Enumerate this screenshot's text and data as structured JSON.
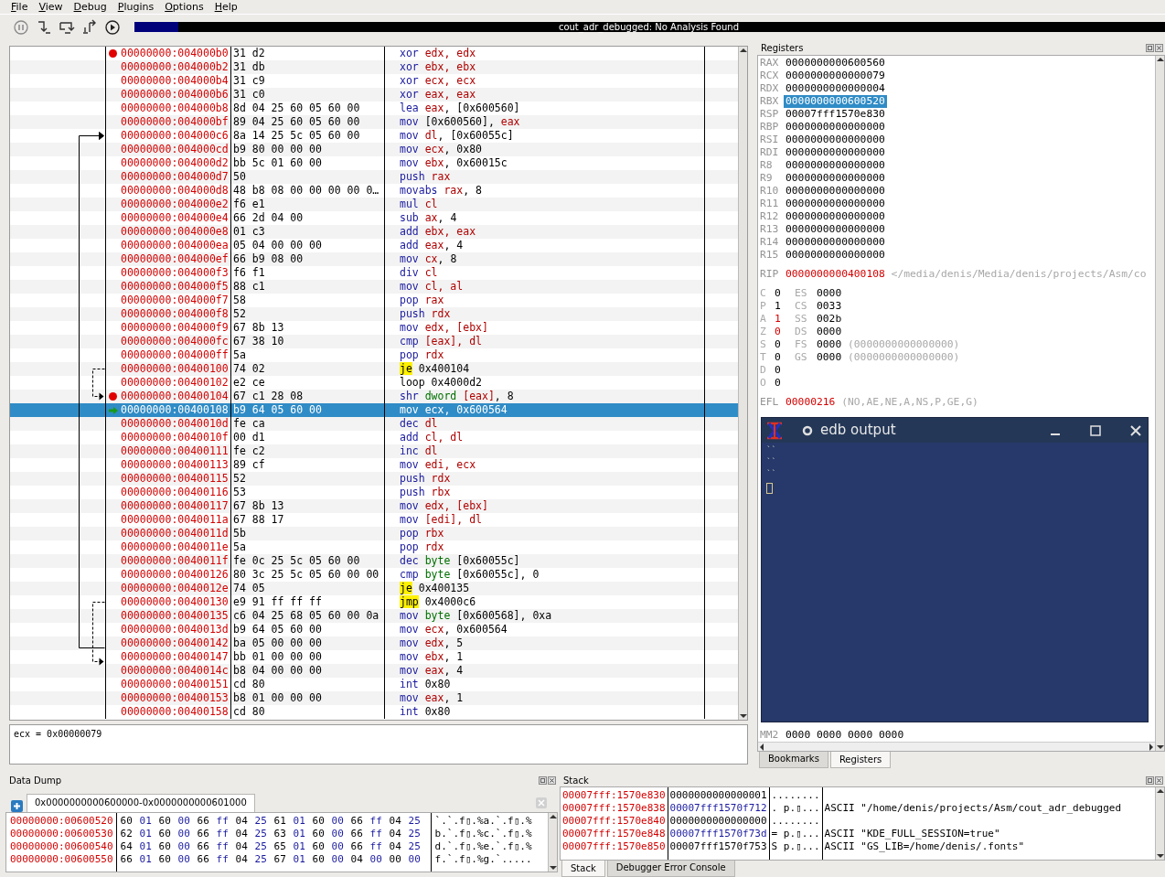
{
  "menu": [
    {
      "label": "File"
    },
    {
      "label": "View"
    },
    {
      "label": "Debug"
    },
    {
      "label": "Plugins"
    },
    {
      "label": "Options"
    },
    {
      "label": "Help"
    }
  ],
  "analysis": {
    "level": 0.043,
    "text": "cout_adr_debugged: No Analysis Found"
  },
  "disassembly": [
    {
      "address": "00000000:004000b0",
      "bytes": "31 d2",
      "mnemonic": "xor",
      "kind": "op",
      "ops": [
        {
          "kind": "r",
          "text": "edx, edx"
        }
      ],
      "breakpoint": true,
      "current": false
    },
    {
      "address": "00000000:004000b2",
      "bytes": "31 db",
      "mnemonic": "xor",
      "kind": "op",
      "ops": [
        {
          "kind": "r",
          "text": "ebx, ebx"
        }
      ],
      "breakpoint": false,
      "current": false
    },
    {
      "address": "00000000:004000b4",
      "bytes": "31 c9",
      "mnemonic": "xor",
      "kind": "op",
      "ops": [
        {
          "kind": "r",
          "text": "ecx, ecx"
        }
      ],
      "breakpoint": false,
      "current": false
    },
    {
      "address": "00000000:004000b6",
      "bytes": "31 c0",
      "mnemonic": "xor",
      "kind": "op",
      "ops": [
        {
          "kind": "r",
          "text": "eax, eax"
        }
      ],
      "breakpoint": false,
      "current": false
    },
    {
      "address": "00000000:004000b8",
      "bytes": "8d 04 25 60 05 60 00",
      "mnemonic": "lea",
      "kind": "op",
      "ops": [
        {
          "kind": "r",
          "text": "eax"
        },
        {
          "kind": "n",
          "text": ", [0x600560]"
        }
      ],
      "breakpoint": false,
      "current": false
    },
    {
      "address": "00000000:004000bf",
      "bytes": "89 04 25 60 05 60 00",
      "mnemonic": "mov",
      "kind": "op",
      "ops": [
        {
          "kind": "n",
          "text": "[0x600560], "
        },
        {
          "kind": "r",
          "text": "eax"
        }
      ],
      "breakpoint": false,
      "current": false
    },
    {
      "address": "00000000:004000c6",
      "bytes": "8a 14 25 5c 05 60 00",
      "mnemonic": "mov",
      "kind": "op",
      "ops": [
        {
          "kind": "r",
          "text": "dl"
        },
        {
          "kind": "n",
          "text": ", [0x60055c]"
        }
      ],
      "breakpoint": false,
      "current": false
    },
    {
      "address": "00000000:004000cd",
      "bytes": "b9 80 00 00 00",
      "mnemonic": "mov",
      "kind": "op",
      "ops": [
        {
          "kind": "r",
          "text": "ecx"
        },
        {
          "kind": "n",
          "text": ", 0x80"
        }
      ],
      "breakpoint": false,
      "current": false
    },
    {
      "address": "00000000:004000d2",
      "bytes": "bb 5c 01 60 00",
      "mnemonic": "mov",
      "kind": "op",
      "ops": [
        {
          "kind": "r",
          "text": "ebx"
        },
        {
          "kind": "n",
          "text": ", 0x60015c"
        }
      ],
      "breakpoint": false,
      "current": false
    },
    {
      "address": "00000000:004000d7",
      "bytes": "50",
      "mnemonic": "push",
      "kind": "op",
      "ops": [
        {
          "kind": "r",
          "text": "rax"
        }
      ],
      "breakpoint": false,
      "current": false
    },
    {
      "address": "00000000:004000d8",
      "bytes": "48 b8 08 00 00 00 00 0…",
      "mnemonic": "movabs",
      "kind": "op",
      "ops": [
        {
          "kind": "r",
          "text": "rax"
        },
        {
          "kind": "n",
          "text": ", 8"
        }
      ],
      "breakpoint": false,
      "current": false
    },
    {
      "address": "00000000:004000e2",
      "bytes": "f6 e1",
      "mnemonic": "mul",
      "kind": "op",
      "ops": [
        {
          "kind": "r",
          "text": "cl"
        }
      ],
      "breakpoint": false,
      "current": false
    },
    {
      "address": "00000000:004000e4",
      "bytes": "66 2d 04 00",
      "mnemonic": "sub",
      "kind": "op",
      "ops": [
        {
          "kind": "r",
          "text": "ax"
        },
        {
          "kind": "n",
          "text": ", 4"
        }
      ],
      "breakpoint": false,
      "current": false
    },
    {
      "address": "00000000:004000e8",
      "bytes": "01 c3",
      "mnemonic": "add",
      "kind": "op",
      "ops": [
        {
          "kind": "r",
          "text": "ebx, eax"
        }
      ],
      "breakpoint": false,
      "current": false
    },
    {
      "address": "00000000:004000ea",
      "bytes": "05 04 00 00 00",
      "mnemonic": "add",
      "kind": "op",
      "ops": [
        {
          "kind": "r",
          "text": "eax"
        },
        {
          "kind": "n",
          "text": ", 4"
        }
      ],
      "breakpoint": false,
      "current": false
    },
    {
      "address": "00000000:004000ef",
      "bytes": "66 b9 08 00",
      "mnemonic": "mov",
      "kind": "op",
      "ops": [
        {
          "kind": "r",
          "text": "cx"
        },
        {
          "kind": "n",
          "text": ", 8"
        }
      ],
      "breakpoint": false,
      "current": false
    },
    {
      "address": "00000000:004000f3",
      "bytes": "f6 f1",
      "mnemonic": "div",
      "kind": "op",
      "ops": [
        {
          "kind": "r",
          "text": "cl"
        }
      ],
      "breakpoint": false,
      "current": false
    },
    {
      "address": "00000000:004000f5",
      "bytes": "88 c1",
      "mnemonic": "mov",
      "kind": "op",
      "ops": [
        {
          "kind": "r",
          "text": "cl, al"
        }
      ],
      "breakpoint": false,
      "current": false
    },
    {
      "address": "00000000:004000f7",
      "bytes": "58",
      "mnemonic": "pop",
      "kind": "op",
      "ops": [
        {
          "kind": "r",
          "text": "rax"
        }
      ],
      "breakpoint": false,
      "current": false
    },
    {
      "address": "00000000:004000f8",
      "bytes": "52",
      "mnemonic": "push",
      "kind": "op",
      "ops": [
        {
          "kind": "r",
          "text": "rdx"
        }
      ],
      "breakpoint": false,
      "current": false
    },
    {
      "address": "00000000:004000f9",
      "bytes": "67 8b 13",
      "mnemonic": "mov",
      "kind": "op",
      "ops": [
        {
          "kind": "r",
          "text": "edx, [ebx]"
        }
      ],
      "breakpoint": false,
      "current": false
    },
    {
      "address": "00000000:004000fc",
      "bytes": "67 38 10",
      "mnemonic": "cmp",
      "kind": "op",
      "ops": [
        {
          "kind": "r",
          "text": "[eax], dl"
        }
      ],
      "breakpoint": false,
      "current": false
    },
    {
      "address": "00000000:004000ff",
      "bytes": "5a",
      "mnemonic": "pop",
      "kind": "op",
      "ops": [
        {
          "kind": "r",
          "text": "rdx"
        }
      ],
      "breakpoint": false,
      "current": false
    },
    {
      "address": "00000000:00400100",
      "bytes": "74 02",
      "mnemonic": "je",
      "kind": "jump",
      "ops": [
        {
          "kind": "n",
          "text": "0x400104"
        }
      ],
      "breakpoint": false,
      "current": false
    },
    {
      "address": "00000000:00400102",
      "bytes": "e2 ce",
      "mnemonic": "loop",
      "kind": "loop",
      "ops": [
        {
          "kind": "n",
          "text": "0x4000d2"
        }
      ],
      "breakpoint": false,
      "current": false
    },
    {
      "address": "00000000:00400104",
      "bytes": "67 c1 28 08",
      "mnemonic": "shr",
      "kind": "op",
      "ops": [
        {
          "kind": "s",
          "text": "dword "
        },
        {
          "kind": "r",
          "text": "[eax]"
        },
        {
          "kind": "n",
          "text": ", 8"
        }
      ],
      "breakpoint": true,
      "current": false
    },
    {
      "address": "00000000:00400108",
      "bytes": "b9 64 05 60 00",
      "mnemonic": "mov",
      "kind": "op",
      "ops": [
        {
          "kind": "r",
          "text": "ecx"
        },
        {
          "kind": "n",
          "text": ", 0x600564"
        }
      ],
      "breakpoint": false,
      "current": true
    },
    {
      "address": "00000000:0040010d",
      "bytes": "fe ca",
      "mnemonic": "dec",
      "kind": "op",
      "ops": [
        {
          "kind": "r",
          "text": "dl"
        }
      ],
      "breakpoint": false,
      "current": false
    },
    {
      "address": "00000000:0040010f",
      "bytes": "00 d1",
      "mnemonic": "add",
      "kind": "op",
      "ops": [
        {
          "kind": "r",
          "text": "cl, dl"
        }
      ],
      "breakpoint": false,
      "current": false
    },
    {
      "address": "00000000:00400111",
      "bytes": "fe c2",
      "mnemonic": "inc",
      "kind": "op",
      "ops": [
        {
          "kind": "r",
          "text": "dl"
        }
      ],
      "breakpoint": false,
      "current": false
    },
    {
      "address": "00000000:00400113",
      "bytes": "89 cf",
      "mnemonic": "mov",
      "kind": "op",
      "ops": [
        {
          "kind": "r",
          "text": "edi, ecx"
        }
      ],
      "breakpoint": false,
      "current": false
    },
    {
      "address": "00000000:00400115",
      "bytes": "52",
      "mnemonic": "push",
      "kind": "op",
      "ops": [
        {
          "kind": "r",
          "text": "rdx"
        }
      ],
      "breakpoint": false,
      "current": false
    },
    {
      "address": "00000000:00400116",
      "bytes": "53",
      "mnemonic": "push",
      "kind": "op",
      "ops": [
        {
          "kind": "r",
          "text": "rbx"
        }
      ],
      "breakpoint": false,
      "current": false
    },
    {
      "address": "00000000:00400117",
      "bytes": "67 8b 13",
      "mnemonic": "mov",
      "kind": "op",
      "ops": [
        {
          "kind": "r",
          "text": "edx, [ebx]"
        }
      ],
      "breakpoint": false,
      "current": false
    },
    {
      "address": "00000000:0040011a",
      "bytes": "67 88 17",
      "mnemonic": "mov",
      "kind": "op",
      "ops": [
        {
          "kind": "r",
          "text": "[edi], dl"
        }
      ],
      "breakpoint": false,
      "current": false
    },
    {
      "address": "00000000:0040011d",
      "bytes": "5b",
      "mnemonic": "pop",
      "kind": "op",
      "ops": [
        {
          "kind": "r",
          "text": "rbx"
        }
      ],
      "breakpoint": false,
      "current": false
    },
    {
      "address": "00000000:0040011e",
      "bytes": "5a",
      "mnemonic": "pop",
      "kind": "op",
      "ops": [
        {
          "kind": "r",
          "text": "rdx"
        }
      ],
      "breakpoint": false,
      "current": false
    },
    {
      "address": "00000000:0040011f",
      "bytes": "fe 0c 25 5c 05 60 00",
      "mnemonic": "dec",
      "kind": "op",
      "ops": [
        {
          "kind": "s",
          "text": "byte "
        },
        {
          "kind": "n",
          "text": "[0x60055c]"
        }
      ],
      "breakpoint": false,
      "current": false
    },
    {
      "address": "00000000:00400126",
      "bytes": "80 3c 25 5c 05 60 00 00",
      "mnemonic": "cmp",
      "kind": "op",
      "ops": [
        {
          "kind": "s",
          "text": "byte "
        },
        {
          "kind": "n",
          "text": "[0x60055c], 0"
        }
      ],
      "breakpoint": false,
      "current": false
    },
    {
      "address": "00000000:0040012e",
      "bytes": "74 05",
      "mnemonic": "je",
      "kind": "jump",
      "ops": [
        {
          "kind": "n",
          "text": "0x400135"
        }
      ],
      "breakpoint": false,
      "current": false
    },
    {
      "address": "00000000:00400130",
      "bytes": "e9 91 ff ff ff",
      "mnemonic": "jmp",
      "kind": "jump",
      "ops": [
        {
          "kind": "n",
          "text": "0x4000c6"
        }
      ],
      "breakpoint": false,
      "current": false
    },
    {
      "address": "00000000:00400135",
      "bytes": "c6 04 25 68 05 60 00 0a",
      "mnemonic": "mov",
      "kind": "op",
      "ops": [
        {
          "kind": "s",
          "text": "byte "
        },
        {
          "kind": "n",
          "text": "[0x600568], 0xa"
        }
      ],
      "breakpoint": false,
      "current": false
    },
    {
      "address": "00000000:0040013d",
      "bytes": "b9 64 05 60 00",
      "mnemonic": "mov",
      "kind": "op",
      "ops": [
        {
          "kind": "r",
          "text": "ecx"
        },
        {
          "kind": "n",
          "text": ", 0x600564"
        }
      ],
      "breakpoint": false,
      "current": false
    },
    {
      "address": "00000000:00400142",
      "bytes": "ba 05 00 00 00",
      "mnemonic": "mov",
      "kind": "op",
      "ops": [
        {
          "kind": "r",
          "text": "edx"
        },
        {
          "kind": "n",
          "text": ", 5"
        }
      ],
      "breakpoint": false,
      "current": false
    },
    {
      "address": "00000000:00400147",
      "bytes": "bb 01 00 00 00",
      "mnemonic": "mov",
      "kind": "op",
      "ops": [
        {
          "kind": "r",
          "text": "ebx"
        },
        {
          "kind": "n",
          "text": ", 1"
        }
      ],
      "breakpoint": false,
      "current": false
    },
    {
      "address": "00000000:0040014c",
      "bytes": "b8 04 00 00 00",
      "mnemonic": "mov",
      "kind": "op",
      "ops": [
        {
          "kind": "r",
          "text": "eax"
        },
        {
          "kind": "n",
          "text": ", 4"
        }
      ],
      "breakpoint": false,
      "current": false
    },
    {
      "address": "00000000:00400151",
      "bytes": "cd 80",
      "mnemonic": "int",
      "kind": "op",
      "ops": [
        {
          "kind": "n",
          "text": "0x80"
        }
      ],
      "breakpoint": false,
      "current": false
    },
    {
      "address": "00000000:00400153",
      "bytes": "b8 01 00 00 00",
      "mnemonic": "mov",
      "kind": "op",
      "ops": [
        {
          "kind": "r",
          "text": "eax"
        },
        {
          "kind": "n",
          "text": ", 1"
        }
      ],
      "breakpoint": false,
      "current": false
    },
    {
      "address": "00000000:00400158",
      "bytes": "cd 80",
      "mnemonic": "int",
      "kind": "op",
      "ops": [
        {
          "kind": "n",
          "text": "0x80"
        }
      ],
      "breakpoint": false,
      "current": false
    }
  ],
  "status": "ecx = 0x00000079",
  "registers": {
    "title": "Registers",
    "general": [
      {
        "name": "RAX",
        "value": "0000000000600560",
        "selected": false
      },
      {
        "name": "RCX",
        "value": "0000000000000079",
        "selected": false
      },
      {
        "name": "RDX",
        "value": "0000000000000004",
        "selected": false
      },
      {
        "name": "RBX",
        "value": "0000000000600520",
        "selected": true
      },
      {
        "name": "RSP",
        "value": "00007fff1570e830",
        "selected": false
      },
      {
        "name": "RBP",
        "value": "0000000000000000",
        "selected": false
      },
      {
        "name": "RSI",
        "value": "0000000000000000",
        "selected": false
      },
      {
        "name": "RDI",
        "value": "0000000000000000",
        "selected": false
      },
      {
        "name": "R8",
        "value": "0000000000000000",
        "selected": false
      },
      {
        "name": "R9",
        "value": "0000000000000000",
        "selected": false
      },
      {
        "name": "R10",
        "value": "0000000000000000",
        "selected": false
      },
      {
        "name": "R11",
        "value": "0000000000000000",
        "selected": false
      },
      {
        "name": "R12",
        "value": "0000000000000000",
        "selected": false
      },
      {
        "name": "R13",
        "value": "0000000000000000",
        "selected": false
      },
      {
        "name": "R14",
        "value": "0000000000000000",
        "selected": false
      },
      {
        "name": "R15",
        "value": "0000000000000000",
        "selected": false
      }
    ],
    "rip": {
      "name": "RIP",
      "value": "0000000000400108",
      "symbol": "</media/denis/Media/denis/projects/Asm/co"
    },
    "flags": [
      {
        "name": "C",
        "value": "0",
        "changed": false
      },
      {
        "name": "P",
        "value": "1",
        "changed": false
      },
      {
        "name": "A",
        "value": "1",
        "changed": true
      },
      {
        "name": "Z",
        "value": "0",
        "changed": true
      },
      {
        "name": "S",
        "value": "0",
        "changed": false
      },
      {
        "name": "T",
        "value": "0",
        "changed": false
      },
      {
        "name": "D",
        "value": "0",
        "changed": false
      },
      {
        "name": "O",
        "value": "0",
        "changed": false
      }
    ],
    "segments": [
      {
        "name": "ES",
        "value": "0000"
      },
      {
        "name": "CS",
        "value": "0033"
      },
      {
        "name": "SS",
        "value": "002b"
      },
      {
        "name": "DS",
        "value": "0000"
      },
      {
        "name": "FS",
        "value": "0000",
        "base": "(0000000000000000)"
      },
      {
        "name": "GS",
        "value": "0000",
        "base": "(0000000000000000)"
      }
    ],
    "efl": {
      "name": "EFL",
      "value": "00000216",
      "decoded": "(NO,AE,NE,A,NS,P,GE,G)"
    },
    "mm2": {
      "name": "MM2",
      "value": "0000 0000 0000 0000"
    },
    "tabs": [
      {
        "label": "Bookmarks",
        "selected": false
      },
      {
        "label": "Registers",
        "selected": true
      }
    ]
  },
  "output_window": {
    "title": "edb output",
    "lines": [
      "``",
      "``",
      "``"
    ]
  },
  "data_dump": {
    "title": "Data Dump",
    "tab": "0x0000000000600000-0x0000000000601000",
    "rows": [
      {
        "address": "00000000:00600520",
        "bytes": [
          "60",
          "01",
          "60",
          "00",
          "66",
          "ff",
          "04",
          "25",
          "61",
          "01",
          "60",
          "00",
          "66",
          "ff",
          "04",
          "25"
        ],
        "ascii": "`.`.f▯.%a.`.f▯.%"
      },
      {
        "address": "00000000:00600530",
        "bytes": [
          "62",
          "01",
          "60",
          "00",
          "66",
          "ff",
          "04",
          "25",
          "63",
          "01",
          "60",
          "00",
          "66",
          "ff",
          "04",
          "25"
        ],
        "ascii": "b.`.f▯.%c.`.f▯.%"
      },
      {
        "address": "00000000:00600540",
        "bytes": [
          "64",
          "01",
          "60",
          "00",
          "66",
          "ff",
          "04",
          "25",
          "65",
          "01",
          "60",
          "00",
          "66",
          "ff",
          "04",
          "25"
        ],
        "ascii": "d.`.f▯.%e.`.f▯.%"
      },
      {
        "address": "00000000:00600550",
        "bytes": [
          "66",
          "01",
          "60",
          "00",
          "66",
          "ff",
          "04",
          "25",
          "67",
          "01",
          "60",
          "00",
          "04",
          "00",
          "00",
          "00"
        ],
        "ascii": "f.`.f▯.%g.`....."
      }
    ]
  },
  "stack": {
    "title": "Stack",
    "rows": [
      {
        "address": "00007fff:1570e830",
        "value": "0000000000000001",
        "pointer": false,
        "ascii": "........",
        "comment": ""
      },
      {
        "address": "00007fff:1570e838",
        "value": "00007fff1570f712",
        "pointer": true,
        "ascii": ". p.▯...",
        "comment": "ASCII \"/home/denis/projects/Asm/cout_adr_debugged"
      },
      {
        "address": "00007fff:1570e840",
        "value": "0000000000000000",
        "pointer": false,
        "ascii": "........",
        "comment": ""
      },
      {
        "address": "00007fff:1570e848",
        "value": "00007fff1570f73d",
        "pointer": true,
        "ascii": "= p.▯...",
        "comment": "ASCII \"KDE_FULL_SESSION=true\""
      },
      {
        "address": "00007fff:1570e850",
        "value": "00007fff1570f753",
        "pointer": false,
        "ascii": "S p.▯...",
        "comment": "ASCII \"GS_LIB=/home/denis/.fonts\""
      }
    ],
    "tabs": [
      {
        "label": "Stack",
        "selected": true
      },
      {
        "label": "Debugger Error Console",
        "selected": false
      }
    ]
  }
}
